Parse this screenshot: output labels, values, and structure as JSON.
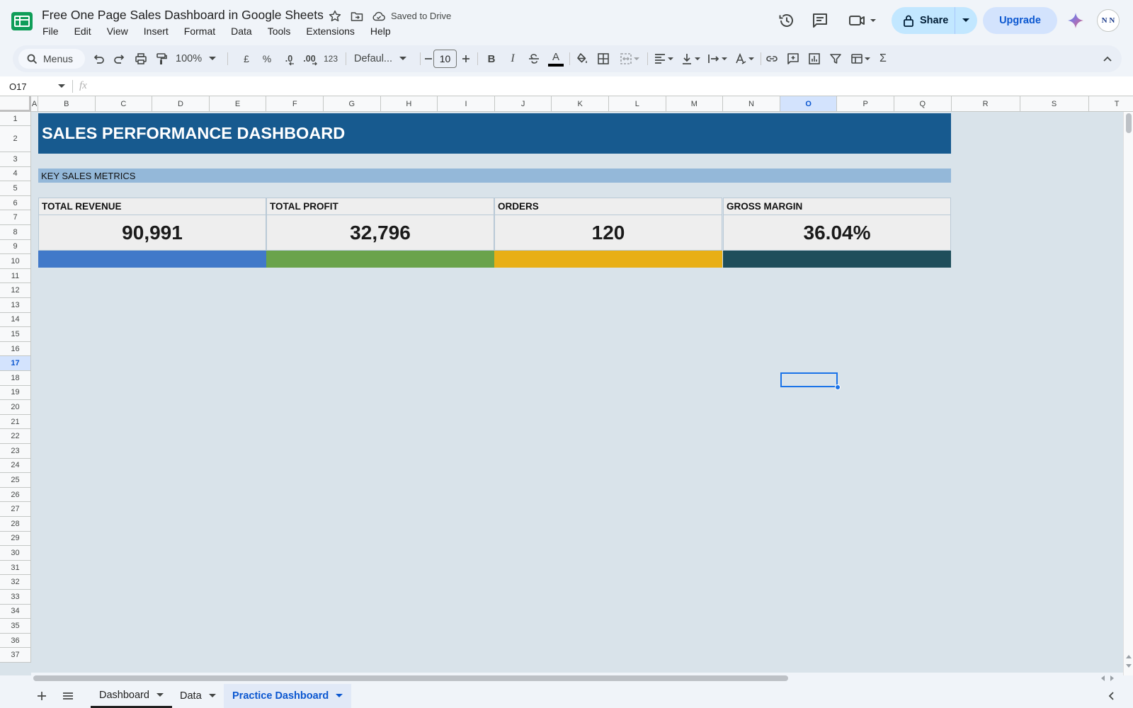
{
  "document": {
    "title": "Free One Page Sales Dashboard in Google Sheets",
    "save_status": "Saved to Drive"
  },
  "menu": [
    "File",
    "Edit",
    "View",
    "Insert",
    "Format",
    "Data",
    "Tools",
    "Extensions",
    "Help"
  ],
  "header_actions": {
    "share_label": "Share",
    "upgrade_label": "Upgrade",
    "avatar_initials": "N N"
  },
  "toolbar": {
    "search_label": "Menus",
    "zoom": "100%",
    "currency_symbol": "£",
    "percent_symbol": "%",
    "decrease_decimal": ".0",
    "increase_decimal": ".00",
    "number_format": "123",
    "font_family": "Defaul...",
    "font_size": "10",
    "bold": "B",
    "italic": "I",
    "text_color_letter": "A",
    "functions_symbol": "Σ"
  },
  "formula_bar": {
    "cell_reference": "O17",
    "fx_label": "fx",
    "content": ""
  },
  "grid": {
    "columns": [
      "A",
      "B",
      "C",
      "D",
      "E",
      "F",
      "G",
      "H",
      "I",
      "J",
      "K",
      "L",
      "M",
      "N",
      "O",
      "P",
      "Q",
      "R",
      "S",
      "T"
    ],
    "selected_column": "O",
    "rows": [
      "1",
      "2",
      "3",
      "4",
      "5",
      "6",
      "7",
      "8",
      "9",
      "10",
      "11",
      "12",
      "13",
      "14",
      "15",
      "16",
      "17",
      "18",
      "19",
      "20",
      "21",
      "22",
      "23",
      "24",
      "25",
      "26",
      "27",
      "28",
      "29",
      "30",
      "31",
      "32",
      "33",
      "34",
      "35",
      "36",
      "37"
    ],
    "selected_row": "17"
  },
  "dashboard": {
    "title": "SALES PERFORMANCE DASHBOARD",
    "section_label": "KEY SALES METRICS",
    "kpis": [
      {
        "label": "TOTAL REVENUE",
        "value": "90,991",
        "color": "#4179c9"
      },
      {
        "label": "TOTAL PROFIT",
        "value": "32,796",
        "color": "#6aa34b"
      },
      {
        "label": "ORDERS",
        "value": "120",
        "color": "#e8af16"
      },
      {
        "label": "GROSS MARGIN",
        "value": "36.04%",
        "color": "#1f4e5b"
      }
    ]
  },
  "sheets": [
    {
      "name": "Dashboard",
      "active": false
    },
    {
      "name": "Data",
      "active": false
    },
    {
      "name": "Practice Dashboard",
      "active": true
    }
  ]
}
